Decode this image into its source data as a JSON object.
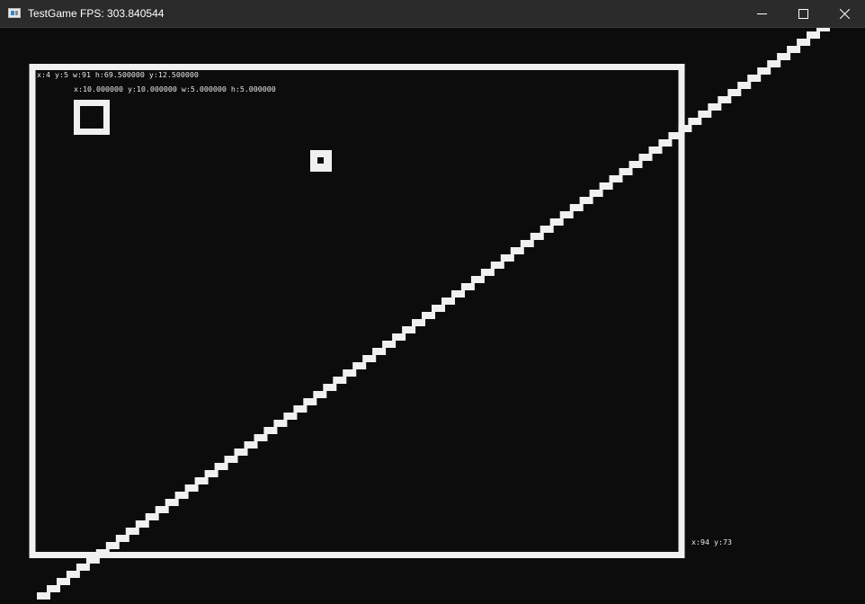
{
  "window": {
    "title": "TestGame FPS: 303.840544"
  },
  "controls": {
    "minimize": "minimize",
    "maximize": "maximize",
    "close": "close"
  },
  "hud": {
    "container_info": "x:4 y:5 w:91 h:69.500000 y:12.500000",
    "child_info": "x:10.000000 y:10.000000 w:5.000000 h:5.000000",
    "cursor_info": "x:94 y:73"
  },
  "colors": {
    "background": "#0c0c0c",
    "foreground": "#f0f0f0",
    "titlebar": "#2b2b2b"
  }
}
